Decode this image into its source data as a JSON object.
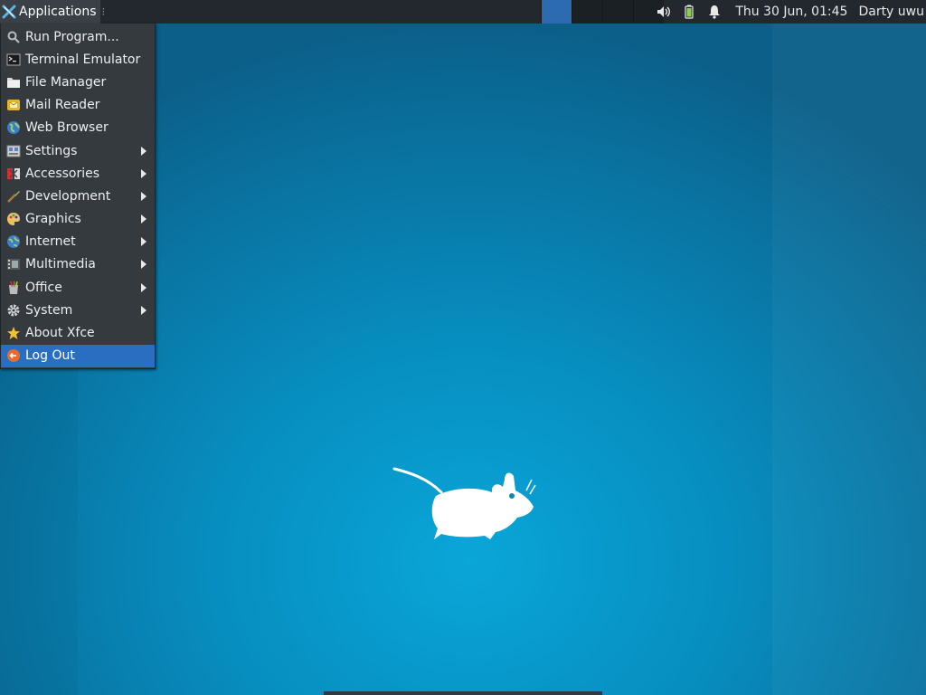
{
  "panel": {
    "applications_label": "Applications",
    "clock": "Thu 30 Jun, 01:45",
    "user": "Darty uwu",
    "workspaces": [
      {
        "active": true
      },
      {
        "active": false
      },
      {
        "active": false
      },
      {
        "active": false
      }
    ],
    "tray_icons": [
      "volume-icon",
      "battery-icon",
      "notification-bell-icon"
    ]
  },
  "menu": {
    "items": [
      {
        "label": "Run Program...",
        "icon": "search-icon",
        "submenu": false
      },
      {
        "label": "Terminal Emulator",
        "icon": "terminal-icon",
        "submenu": false
      },
      {
        "label": "File Manager",
        "icon": "folder-icon",
        "submenu": false
      },
      {
        "label": "Mail Reader",
        "icon": "mail-icon",
        "submenu": false
      },
      {
        "label": "Web Browser",
        "icon": "globe-icon",
        "submenu": false
      },
      {
        "label": "Settings",
        "icon": "settings-icon",
        "submenu": true
      },
      {
        "label": "Accessories",
        "icon": "accessories-icon",
        "submenu": true
      },
      {
        "label": "Development",
        "icon": "development-icon",
        "submenu": true
      },
      {
        "label": "Graphics",
        "icon": "graphics-palette-icon",
        "submenu": true
      },
      {
        "label": "Internet",
        "icon": "internet-globe-icon",
        "submenu": true
      },
      {
        "label": "Multimedia",
        "icon": "multimedia-icon",
        "submenu": true
      },
      {
        "label": "Office",
        "icon": "office-icon",
        "submenu": true
      },
      {
        "label": "System",
        "icon": "gear-icon",
        "submenu": true
      },
      {
        "label": "About Xfce",
        "icon": "star-icon",
        "submenu": false
      },
      {
        "label": "Log Out",
        "icon": "log-out-icon",
        "submenu": false,
        "selected": true
      }
    ]
  },
  "colors": {
    "panel_bg": "#22282d",
    "menu_bg": "#353a3f",
    "selection": "#2a6ec2",
    "desktop": "#078ec0"
  }
}
